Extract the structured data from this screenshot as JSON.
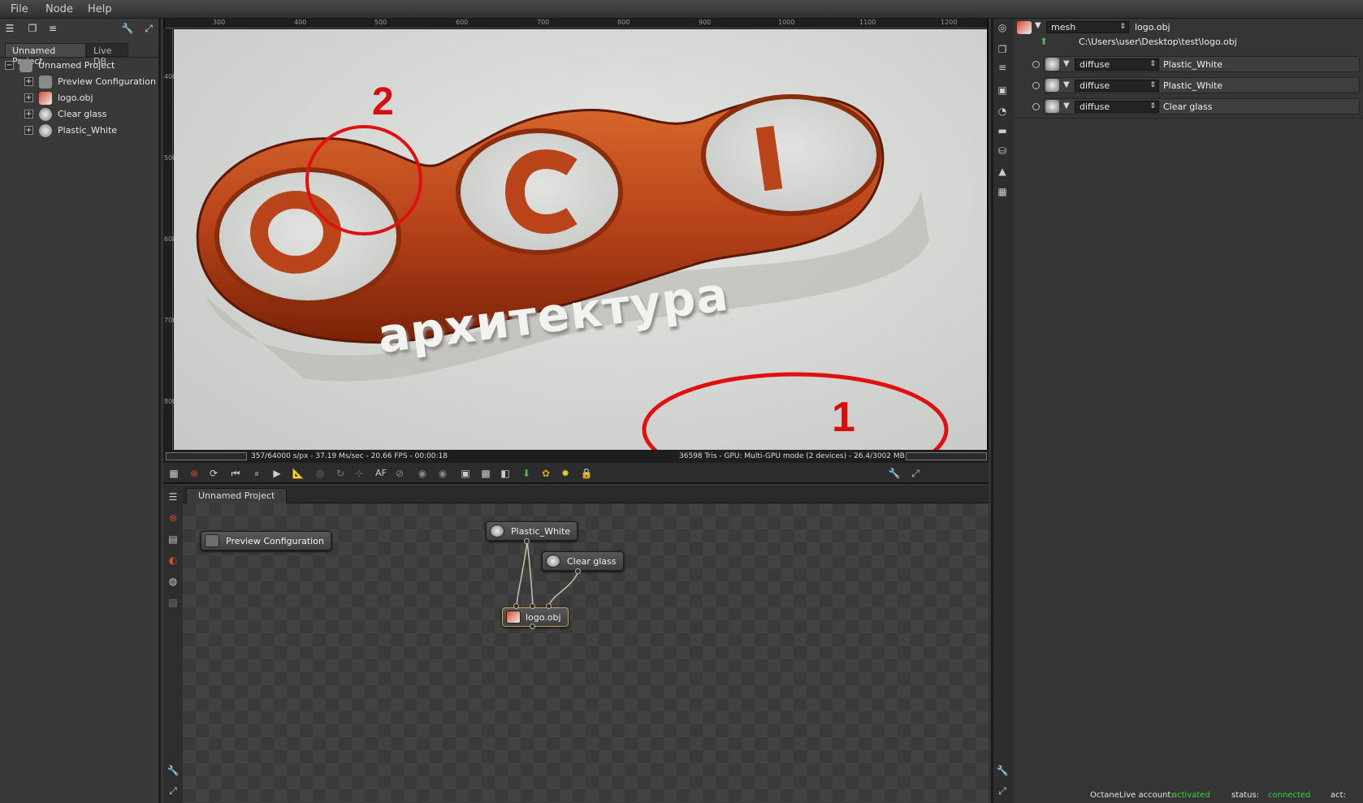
{
  "menubar": {
    "items": [
      "File",
      "Node",
      "Help"
    ]
  },
  "left_panel": {
    "tabs": [
      "Unnamed Project",
      "Live DB"
    ],
    "tree": {
      "root": "Unnamed Project",
      "children": [
        "Preview Configuration",
        "logo.obj",
        "Clear glass",
        "Plastic_White"
      ]
    }
  },
  "viewport": {
    "ruler_top": [
      "300",
      "400",
      "500",
      "600",
      "700",
      "800",
      "900",
      "1000",
      "1100",
      "1200"
    ],
    "ruler_left": [
      "400",
      "500",
      "600",
      "700",
      "800"
    ],
    "render": {
      "text": "архитектура",
      "annotation_1": "1",
      "annotation_2": "2"
    },
    "status_left": "357/64000 s/px - 37.19 Ms/sec - 20.66 FPS - 00:00:18",
    "status_right": "36598 Tris - GPU: Multi-GPU mode (2 devices) - 26.4/3002 MB Used",
    "toolbar_af": "AF"
  },
  "node_graph": {
    "tab": "Unnamed Project",
    "nodes": [
      "Preview Configuration",
      "Plastic_White",
      "Clear glass",
      "logo.obj"
    ]
  },
  "inspector": {
    "header_type": "mesh",
    "header_name": "logo.obj",
    "file_path": "C:\\Users\\user\\Desktop\\test\\logo.obj",
    "rows": [
      {
        "type": "diffuse",
        "value": "Plastic_White"
      },
      {
        "type": "diffuse",
        "value": "Plastic_White"
      },
      {
        "type": "diffuse",
        "value": "Clear glass"
      }
    ]
  },
  "status": {
    "account_label": "OctaneLive account:",
    "account_value": "activated",
    "status_label": "status:",
    "status_value": "connected",
    "act_label": "act:",
    "ok_color": "#39d439"
  }
}
